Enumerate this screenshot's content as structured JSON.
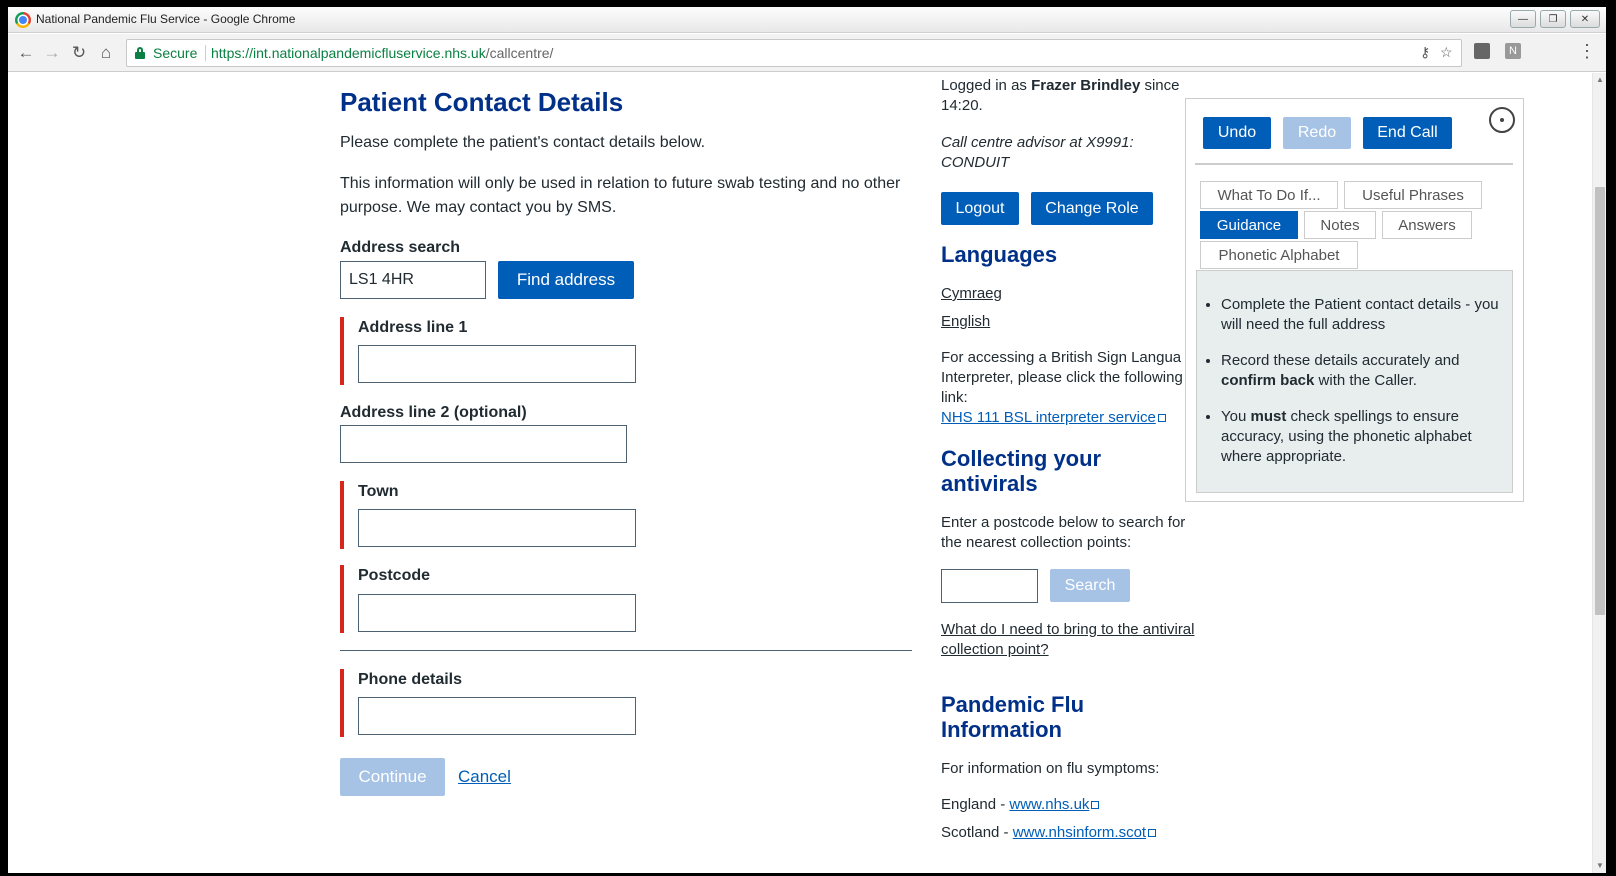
{
  "window": {
    "title": "National Pandemic Flu Service - Google Chrome",
    "min": "—",
    "max": "❐",
    "close": "✕"
  },
  "browser": {
    "back": "←",
    "forward": "→",
    "reload": "↻",
    "home": "⌂",
    "secure_label": "Secure",
    "url_host": "https://int.nationalpandemicfluservice.nhs.uk",
    "url_path": "/callcentre/",
    "key_icon": "⚷",
    "star_icon": "☆",
    "ext_n": "N",
    "menu_icon": "⋮"
  },
  "form": {
    "title": "Patient Contact Details",
    "intro": "Please complete the patient's contact details below.",
    "info": "This information will only be used in relation to future swab testing and no other purpose. We may contact you by SMS.",
    "address_search_label": "Address search",
    "address_search_value": "LS1 4HR",
    "find_address": "Find address",
    "address1_label": "Address line 1",
    "address2_label": "Address line 2 (optional)",
    "town_label": "Town",
    "postcode_label": "Postcode",
    "phone_label": "Phone details",
    "continue": "Continue",
    "cancel": "Cancel"
  },
  "sidebar": {
    "logged_prefix": "Logged in as ",
    "user": "Frazer Brindley",
    "logged_suffix": " since",
    "since_time": "14:20.",
    "role_line1": "Call centre advisor at X9991:",
    "role_line2": "CONDUIT",
    "logout": "Logout",
    "change_role": "Change Role",
    "languages_heading": "Languages",
    "lang_cy": "Cymraeg",
    "lang_en": "English",
    "bsl_line1": "For accessing a British Sign Langua",
    "bsl_line2": "Interpreter, please click the following",
    "bsl_line3": "link:",
    "bsl_link": "NHS 111 BSL interpreter service",
    "collect_heading_1": "Collecting your",
    "collect_heading_2": "antivirals",
    "collect_text_1": "Enter a postcode below to search for",
    "collect_text_2": "the nearest collection points:",
    "search": "Search",
    "bring_link_1": "What do I need to bring to the antiviral",
    "bring_link_2": "collection point?",
    "flu_heading_1": "Pandemic Flu",
    "flu_heading_2": "Information",
    "flu_text": "For information on flu symptoms:",
    "england_prefix": "England - ",
    "england_link": "www.nhs.uk",
    "scotland_prefix": "Scotland - ",
    "scotland_link": "www.nhsinform.scot"
  },
  "panel": {
    "undo": "Undo",
    "redo": "Redo",
    "end_call": "End Call",
    "tabs": [
      "What To Do If...",
      "Useful Phrases",
      "Guidance",
      "Notes",
      "Answers",
      "Phonetic Alphabet"
    ],
    "active_tab": "Guidance",
    "g1": "Complete the Patient contact details - you will need the full address",
    "g2_pre": "Record these details accurately and ",
    "g2_bold": "confirm back",
    "g2_post": " with the Caller.",
    "g3_pre": "You ",
    "g3_bold": "must",
    "g3_post": " check spellings to ensure accuracy, using the phonetic alphabet where appropriate."
  },
  "colors": {
    "nhs_blue": "#005eb8",
    "heading_blue": "#003087",
    "error_red": "#d5281b",
    "secure_green": "#0b8043"
  }
}
